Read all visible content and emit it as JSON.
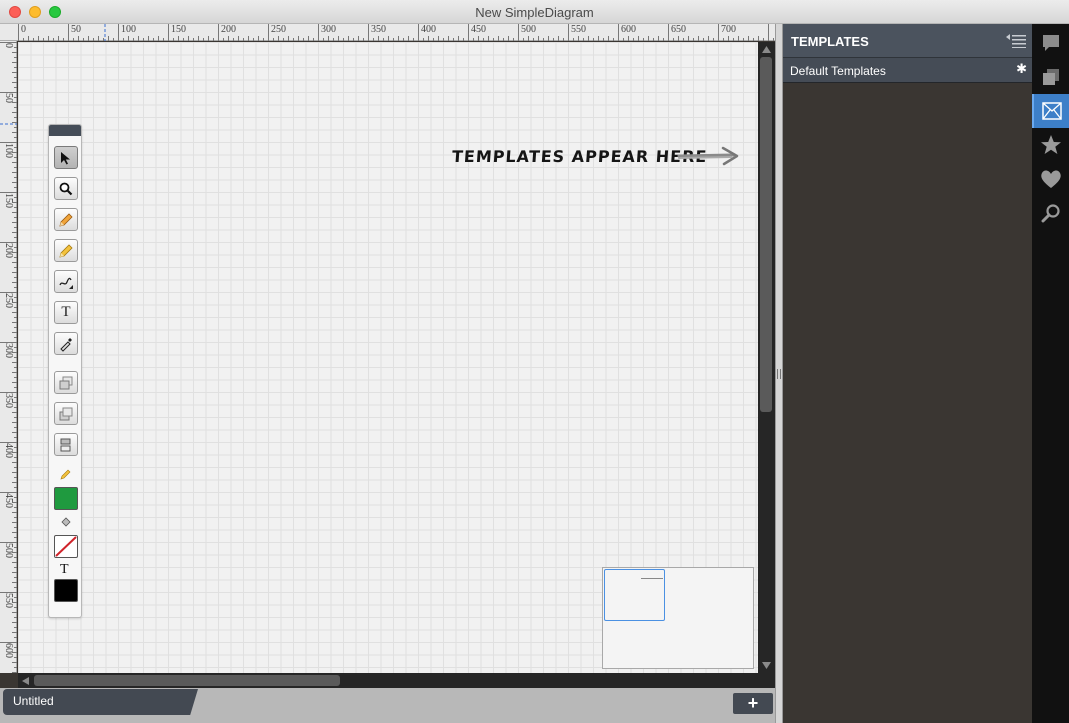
{
  "window": {
    "title": "New SimpleDiagram"
  },
  "ruler_top_labels": [
    "0",
    "50",
    "100",
    "150",
    "200",
    "250",
    "300",
    "350",
    "400",
    "450",
    "500",
    "550",
    "600",
    "650",
    "700"
  ],
  "ruler_left_labels": [
    "0",
    "50",
    "100",
    "150",
    "200",
    "250",
    "300",
    "350",
    "400",
    "450",
    "500",
    "550",
    "600"
  ],
  "canvas": {
    "hint_text": "TEMPLATES APPEAR HERE"
  },
  "toolbox": {
    "tools": [
      {
        "name": "select-tool",
        "icon": "pointer-arrow-icon",
        "active": true
      },
      {
        "name": "zoom-tool",
        "icon": "magnifier-icon"
      },
      {
        "name": "pencil-tool",
        "icon": "pencil-icon"
      },
      {
        "name": "highlighter-tool",
        "icon": "highlighter-icon"
      },
      {
        "name": "connector-tool",
        "icon": "squiggle-icon"
      },
      {
        "name": "text-tool",
        "icon": "text-icon",
        "glyph": "T"
      },
      {
        "name": "eyedropper-tool",
        "icon": "eyedropper-icon"
      },
      {
        "name": "bring-forward-tool",
        "icon": "bring-forward-icon"
      },
      {
        "name": "send-backward-tool",
        "icon": "send-backward-icon"
      },
      {
        "name": "arrange-tool",
        "icon": "arrange-icon"
      }
    ],
    "stroke_color": "#1f9a3f",
    "fill_color": "none",
    "text_color": "#000000",
    "text_glyph": "T"
  },
  "tabs": [
    {
      "label": "Untitled"
    }
  ],
  "add_tab_glyph": "+",
  "panel": {
    "title": "TEMPLATES",
    "section_label": "Default Templates",
    "section_action_glyph": "✱"
  },
  "iconbar": [
    {
      "icon": "speech-bubble-icon"
    },
    {
      "icon": "layers-icon"
    },
    {
      "icon": "templates-icon",
      "active": true
    },
    {
      "icon": "star-icon"
    },
    {
      "icon": "heart-icon"
    },
    {
      "icon": "search-icon"
    }
  ],
  "colors": {
    "accent": "#3d7fc8",
    "panel_header": "#4b535e",
    "panel_bg": "#3a3632"
  }
}
